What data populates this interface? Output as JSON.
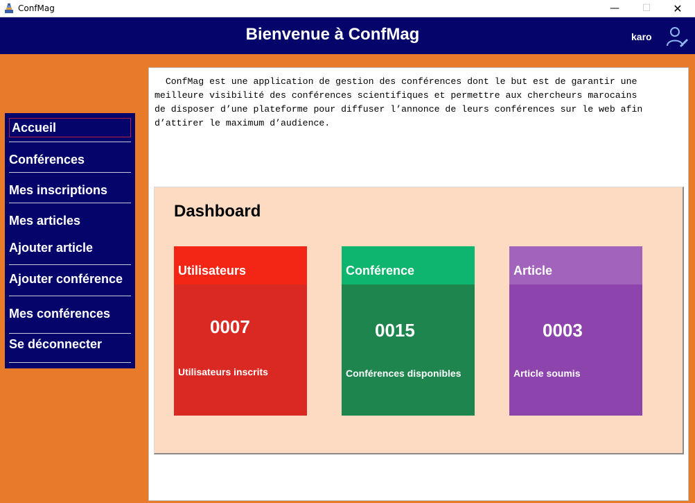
{
  "window": {
    "title": "ConfMag",
    "icons": {
      "app": "confmag-app-icon",
      "minimize": "minimize-icon",
      "maximize": "maximize-icon",
      "close": "close-icon"
    },
    "controls": {
      "minimize": "—",
      "maximize": "☐",
      "close": "✕"
    }
  },
  "header": {
    "title": "Bienvenue à ConfMag",
    "username": "karo",
    "user_icon": "user-edit-icon"
  },
  "sidebar": {
    "items": [
      {
        "label": "Accueil",
        "active": true
      },
      {
        "label": "Conférences"
      },
      {
        "label": "Mes inscriptions"
      },
      {
        "label": "Mes articles"
      },
      {
        "label": "Ajouter article"
      },
      {
        "label": "Ajouter conférence"
      },
      {
        "label": "Mes conférences"
      },
      {
        "label": "Se déconnecter"
      }
    ]
  },
  "intro": {
    "text": "  ConfMag est une application de gestion des conférences dont le but est de garantir une\nmeilleure visibilité des conférences scientifiques et permettre aux chercheurs marocains\nde disposer d’une plateforme pour diffuser l’annonce de leurs conférences sur le web afin\nd’attirer le maximum d’audience."
  },
  "dashboard": {
    "title": "Dashboard",
    "cards": [
      {
        "title": "Utilisateurs",
        "count": "0007",
        "caption": "Utilisateurs inscrits",
        "head_color": "#f32615",
        "body_color": "#da2923"
      },
      {
        "title": "Conférence",
        "count": "0015",
        "caption": "Conférences disponibles",
        "head_color": "#0eb56f",
        "body_color": "#1e854e"
      },
      {
        "title": "Article",
        "count": "0003",
        "caption": "Article soumis",
        "head_color": "#a263bc",
        "body_color": "#8e44ad"
      }
    ]
  },
  "colors": {
    "background": "#e87b29",
    "navy": "#04046b",
    "dashboard_bg": "#fddbc3"
  }
}
